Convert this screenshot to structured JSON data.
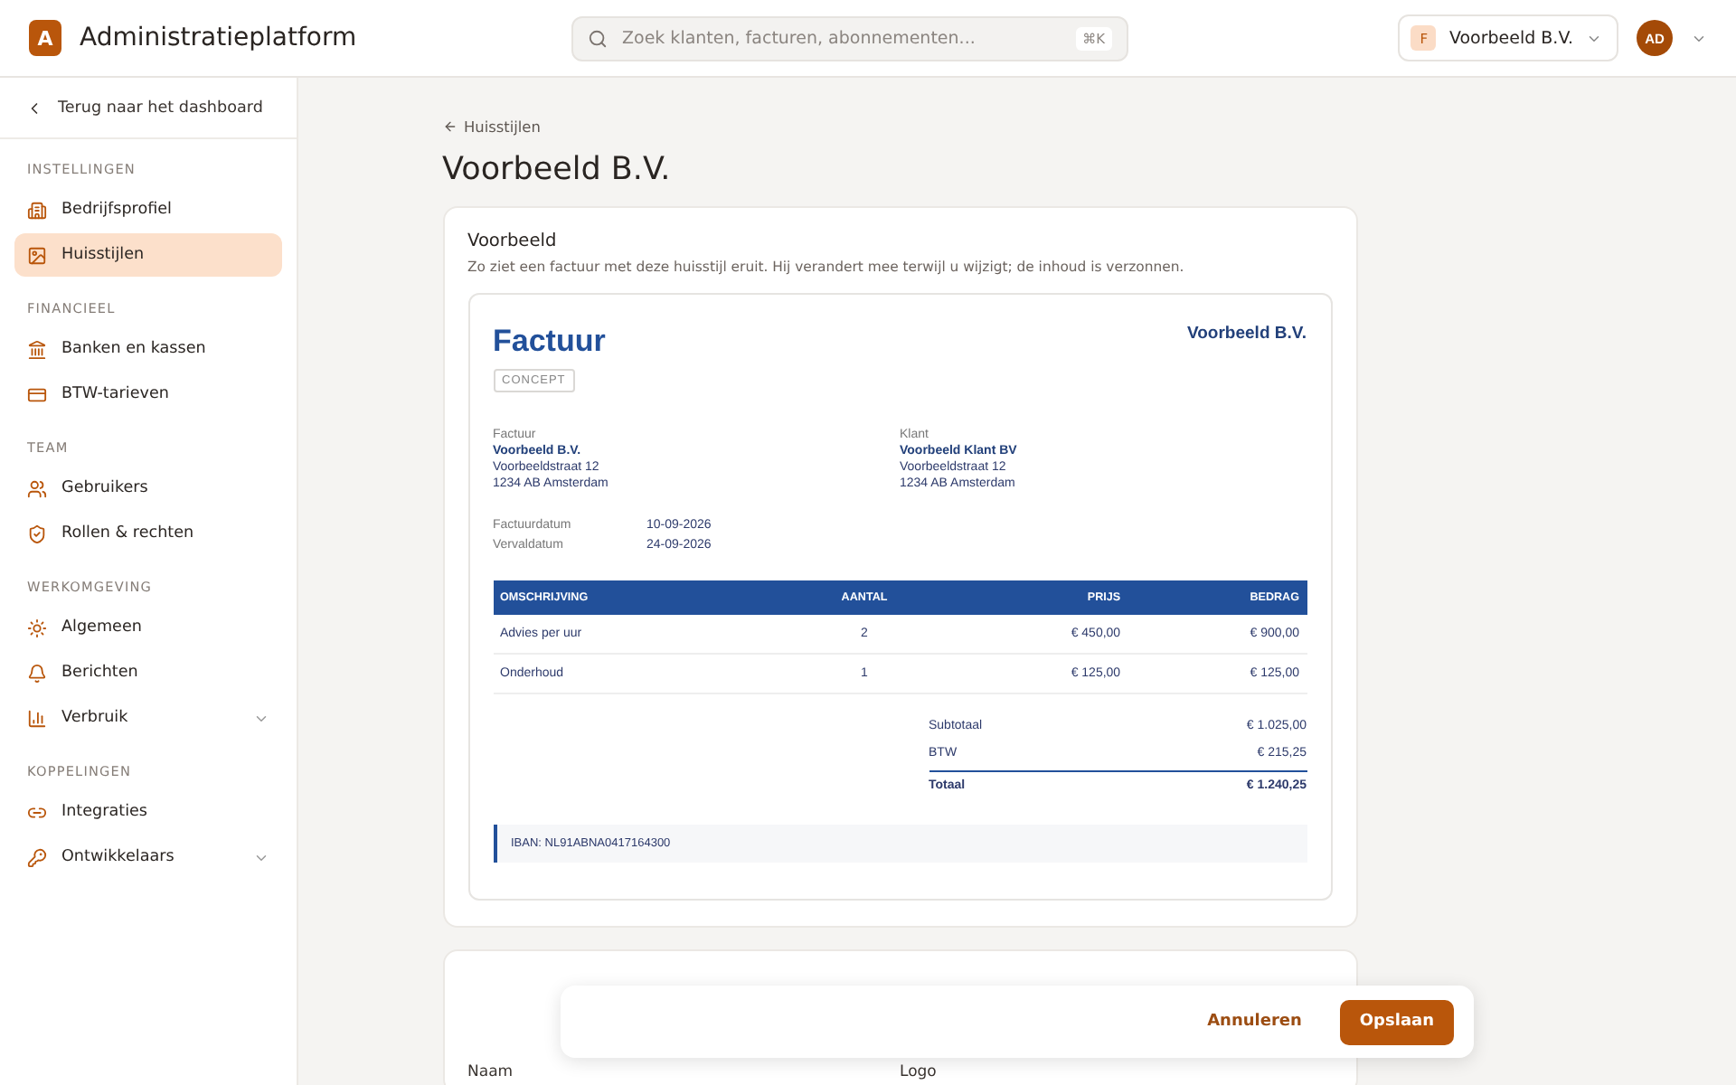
{
  "app": {
    "logo_letter": "A",
    "name": "Administratieplatform"
  },
  "search": {
    "placeholder": "Zoek klanten, facturen, abonnementen...",
    "shortcut": "⌘K"
  },
  "organization": {
    "initial": "F",
    "name": "Voorbeeld B.V."
  },
  "user": {
    "initials": "AD"
  },
  "sidebar": {
    "back": "Terug naar het dashboard",
    "sections": [
      {
        "title": "INSTELLINGEN",
        "items": [
          {
            "label": "Bedrijfsprofiel",
            "kind": "building",
            "selected": false,
            "expandable": false
          },
          {
            "label": "Huisstijlen",
            "kind": "image",
            "selected": true,
            "expandable": false
          }
        ]
      },
      {
        "title": "FINANCIEEL",
        "items": [
          {
            "label": "Banken en kassen",
            "kind": "bank",
            "selected": false,
            "expandable": false
          },
          {
            "label": "BTW-tarieven",
            "kind": "card",
            "selected": false,
            "expandable": false
          }
        ]
      },
      {
        "title": "TEAM",
        "items": [
          {
            "label": "Gebruikers",
            "kind": "users",
            "selected": false,
            "expandable": false
          },
          {
            "label": "Rollen & rechten",
            "kind": "shield",
            "selected": false,
            "expandable": false
          }
        ]
      },
      {
        "title": "WERKOMGEVING",
        "items": [
          {
            "label": "Algemeen",
            "kind": "sun",
            "selected": false,
            "expandable": false
          },
          {
            "label": "Berichten",
            "kind": "bell",
            "selected": false,
            "expandable": false
          },
          {
            "label": "Verbruik",
            "kind": "chart",
            "selected": false,
            "expandable": true
          }
        ]
      },
      {
        "title": "KOPPELINGEN",
        "items": [
          {
            "label": "Integraties",
            "kind": "link",
            "selected": false,
            "expandable": false
          },
          {
            "label": "Ontwikkelaars",
            "kind": "key",
            "selected": false,
            "expandable": true
          }
        ]
      }
    ]
  },
  "page": {
    "breadcrumb": "Huisstijlen",
    "title": "Voorbeeld B.V."
  },
  "preview": {
    "title": "Voorbeeld",
    "description": "Zo ziet een factuur met deze huisstijl eruit. Hij verandert mee terwijl u wijzigt; de inhoud is verzonnen.",
    "invoice": {
      "heading": "Factuur",
      "status": "CONCEPT",
      "company": "Voorbeeld B.V.",
      "parties": [
        {
          "label": "Factuur",
          "name": "Voorbeeld B.V.",
          "lines": [
            "Voorbeeldstraat 12",
            "1234 AB Amsterdam"
          ]
        },
        {
          "label": "Klant",
          "name": "Voorbeeld Klant BV",
          "lines": [
            "Voorbeeldstraat 12",
            "1234 AB Amsterdam"
          ]
        }
      ],
      "dates": [
        {
          "label": "Factuurdatum",
          "value": "10-09-2026"
        },
        {
          "label": "Vervaldatum",
          "value": "24-09-2026"
        }
      ],
      "columns": [
        "OMSCHRIJVING",
        "AANTAL",
        "PRIJS",
        "BEDRAG"
      ],
      "rows": [
        [
          "Advies per uur",
          "2",
          "€ 450,00",
          "€ 900,00"
        ],
        [
          "Onderhoud",
          "1",
          "€ 125,00",
          "€ 125,00"
        ]
      ],
      "totals": [
        {
          "label": "Subtotaal",
          "value": "€ 1.025,00",
          "kind": "sub"
        },
        {
          "label": "BTW",
          "value": "€ 215,25",
          "kind": "sub"
        },
        {
          "label": "Totaal",
          "value": "€ 1.240,25",
          "kind": "total"
        }
      ],
      "footer": "IBAN: NL91ABNA0417164300"
    }
  },
  "next_card": {
    "labels": [
      "Naam",
      "Logo"
    ]
  },
  "actions": [
    {
      "label": "Annuleren",
      "kind": "secondary"
    },
    {
      "label": "Opslaan",
      "kind": "primary"
    }
  ]
}
